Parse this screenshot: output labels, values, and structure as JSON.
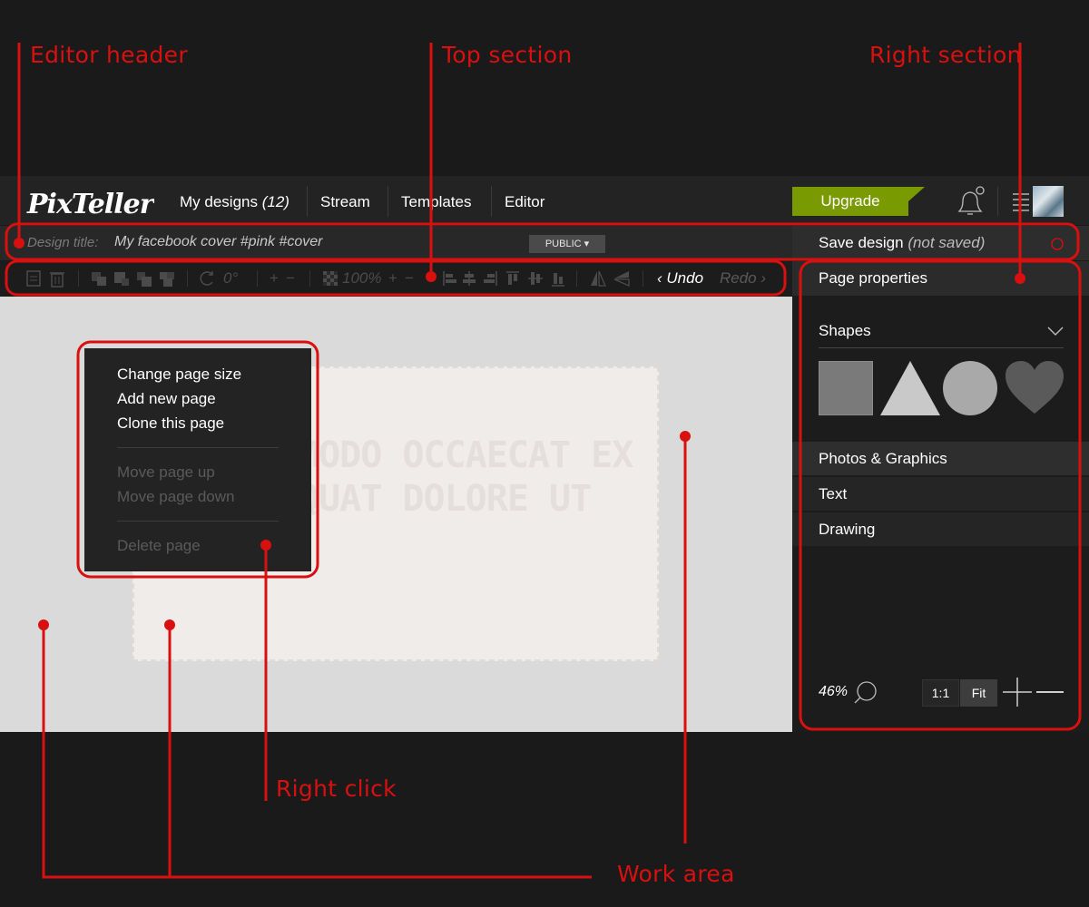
{
  "header": {
    "logo_text": "PixTeller",
    "nav": [
      {
        "label": "My designs",
        "count": "(12)"
      },
      {
        "label": "Stream"
      },
      {
        "label": "Templates"
      },
      {
        "label": "Editor"
      }
    ],
    "upgrade_label": "Upgrade",
    "upgrade_color": "#7a9a01"
  },
  "titlebar": {
    "label": "Design title:",
    "value": "My facebook cover #pink #cover",
    "visibility": "PUBLIC ▾",
    "save_label": "Save design",
    "save_status": "(not saved)"
  },
  "toolbar": {
    "rotation": "0°",
    "opacity": "100%",
    "undo": "‹ Undo",
    "redo": "Redo ›"
  },
  "canvas": {
    "text_line1": "MODO OCCAECAT EX",
    "text_line2": "QUAT DOLORE UT"
  },
  "context_menu": {
    "items": [
      {
        "label": "Change page size",
        "enabled": true
      },
      {
        "label": "Add new page",
        "enabled": true
      },
      {
        "label": "Clone this page",
        "enabled": true
      },
      {
        "label": "Move page up",
        "enabled": false
      },
      {
        "label": "Move page down",
        "enabled": false
      },
      {
        "label": "Delete page",
        "enabled": false
      }
    ]
  },
  "right_panel": {
    "page_properties": "Page properties",
    "shapes_label": "Shapes",
    "shapes": [
      "square",
      "triangle",
      "circle",
      "heart"
    ],
    "sections": [
      "Photos & Graphics",
      "Text",
      "Drawing"
    ],
    "zoom": "46%",
    "btn_actual": "1:1",
    "btn_fit": "Fit"
  },
  "annotations": {
    "editor_header": "Editor header",
    "top_section": "Top section",
    "right_section": "Right section",
    "right_click": "Right click",
    "work_area": "Work area",
    "color": "#d81010"
  }
}
